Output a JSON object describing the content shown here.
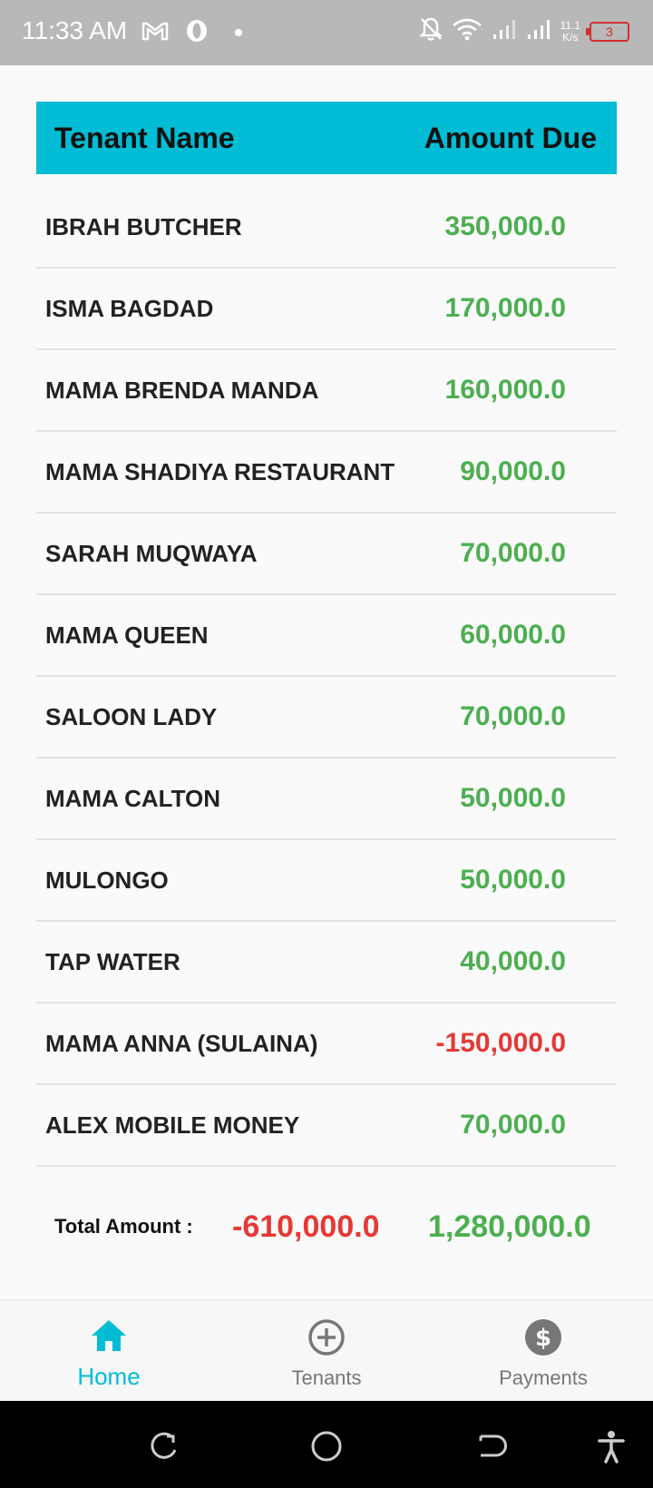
{
  "status_bar": {
    "time": "11:33 AM",
    "speed_value": "11.1",
    "speed_unit": "K/s",
    "battery": "3",
    "icons": [
      "gmail-icon",
      "opera-icon",
      "dot-icon",
      "bell-off-icon",
      "wifi-icon",
      "signal-icon",
      "signal-icon"
    ]
  },
  "table": {
    "header": {
      "name": "Tenant Name",
      "amount": "Amount Due"
    },
    "rows": [
      {
        "name": "IBRAH BUTCHER",
        "amount": "350,000.0",
        "status": "positive"
      },
      {
        "name": "ISMA BAGDAD",
        "amount": "170,000.0",
        "status": "positive"
      },
      {
        "name": "MAMA BRENDA MANDA",
        "amount": "160,000.0",
        "status": "positive"
      },
      {
        "name": "MAMA SHADIYA RESTAURANT",
        "amount": "90,000.0",
        "status": "positive"
      },
      {
        "name": "SARAH MUQWAYA",
        "amount": "70,000.0",
        "status": "positive"
      },
      {
        "name": "MAMA QUEEN",
        "amount": "60,000.0",
        "status": "positive"
      },
      {
        "name": "SALOON LADY",
        "amount": "70,000.0",
        "status": "positive"
      },
      {
        "name": "MAMA CALTON",
        "amount": "50,000.0",
        "status": "positive"
      },
      {
        "name": "MULONGO",
        "amount": "50,000.0",
        "status": "positive"
      },
      {
        "name": "TAP WATER",
        "amount": "40,000.0",
        "status": "positive"
      },
      {
        "name": "MAMA ANNA (SULAINA)",
        "amount": "-150,000.0",
        "status": "negative"
      },
      {
        "name": "ALEX MOBILE MONEY",
        "amount": "70,000.0",
        "status": "positive"
      }
    ]
  },
  "totals": {
    "label": "Total Amount :",
    "negative": "-610,000.0",
    "positive": "1,280,000.0"
  },
  "bottom_nav": {
    "home": "Home",
    "tenants": "Tenants",
    "payments": "Payments",
    "active": "home"
  },
  "colors": {
    "accent": "#00bcd4",
    "positive": "#4caf50",
    "negative": "#e53935"
  }
}
